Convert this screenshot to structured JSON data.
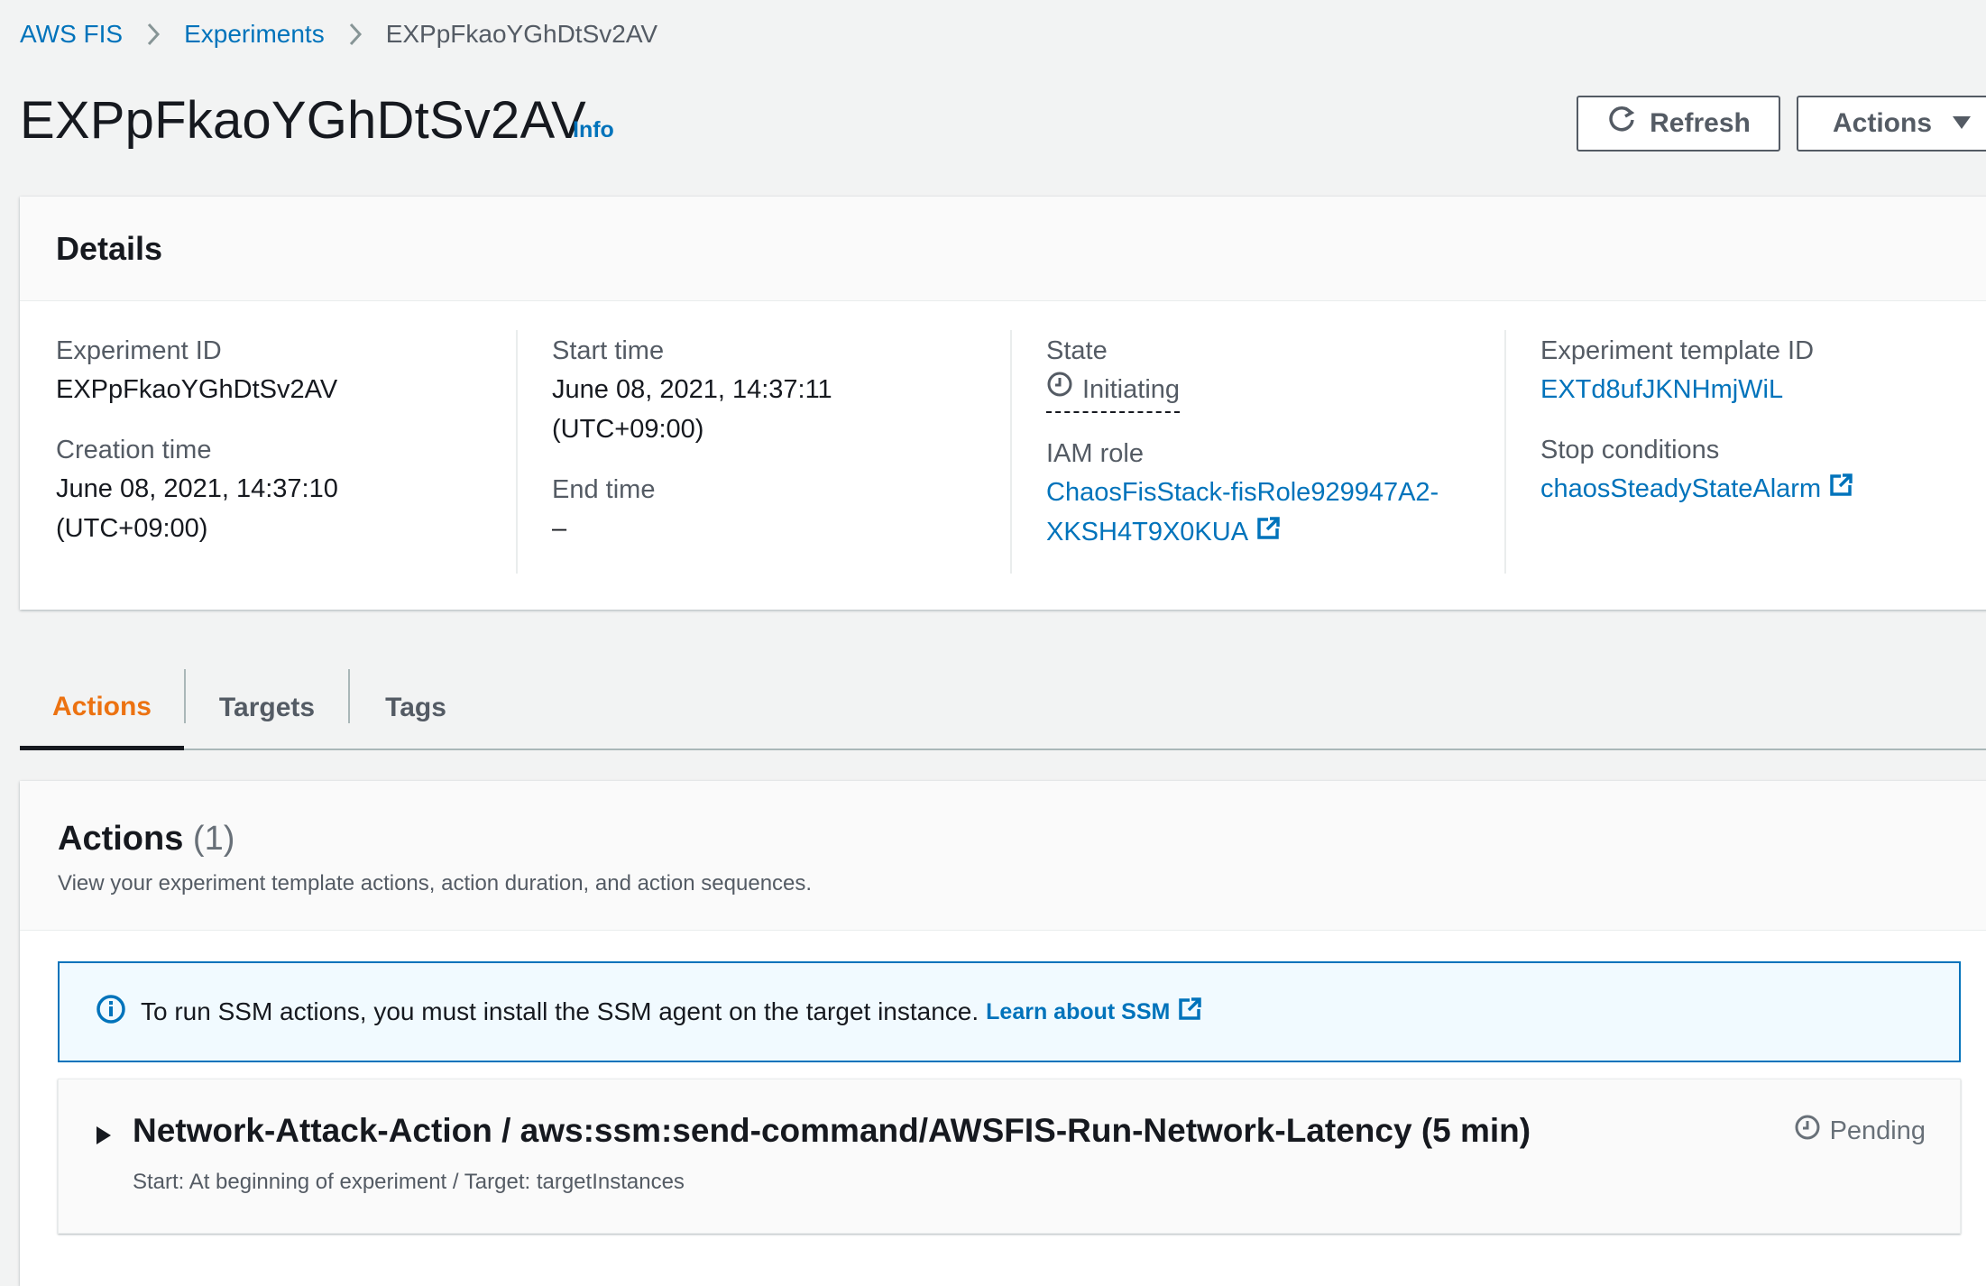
{
  "breadcrumb": {
    "items": [
      "AWS FIS",
      "Experiments"
    ],
    "current": "EXPpFkaoYGhDtSv2AV"
  },
  "header": {
    "title": "EXPpFkaoYGhDtSv2AV",
    "info_label": "Info",
    "refresh_label": "Refresh",
    "actions_label": "Actions"
  },
  "details": {
    "title": "Details",
    "experiment_id_label": "Experiment ID",
    "experiment_id": "EXPpFkaoYGhDtSv2AV",
    "creation_time_label": "Creation time",
    "creation_time_line1": "June 08, 2021, 14:37:10",
    "creation_time_line2": "(UTC+09:00)",
    "start_time_label": "Start time",
    "start_time_line1": "June 08, 2021, 14:37:11",
    "start_time_line2": "(UTC+09:00)",
    "end_time_label": "End time",
    "end_time": "–",
    "state_label": "State",
    "state": "Initiating",
    "iam_role_label": "IAM role",
    "iam_role_line1": "ChaosFisStack-fisRole929947A2-",
    "iam_role_line2": "XKSH4T9X0KUA",
    "template_id_label": "Experiment template ID",
    "template_id": "EXTd8ufJKNHmjWiL",
    "stop_conditions_label": "Stop conditions",
    "stop_condition": "chaosSteadyStateAlarm"
  },
  "tabs": [
    {
      "label": "Actions"
    },
    {
      "label": "Targets"
    },
    {
      "label": "Tags"
    }
  ],
  "actions_section": {
    "title": "Actions",
    "count": "(1)",
    "description": "View your experiment template actions, action duration, and action sequences.",
    "alert_text": "To run SSM actions, you must install the SSM agent on the target instance.",
    "alert_link": "Learn about SSM",
    "items": [
      {
        "title": "Network-Attack-Action / aws:ssm:send-command/AWSFIS-Run-Network-Latency (5 min)",
        "subtitle": "Start: At beginning of experiment / Target: targetInstances",
        "status": "Pending"
      }
    ]
  },
  "colors": {
    "link": "#0073bb",
    "active_tab": "#ec7211",
    "text": "#16191f",
    "muted": "#545b64",
    "background": "#f2f3f3"
  },
  "icons": [
    "chevron-right-icon",
    "refresh-icon",
    "caret-down-icon",
    "clock-icon",
    "external-link-icon",
    "info-icon",
    "expand-triangle-icon"
  ]
}
